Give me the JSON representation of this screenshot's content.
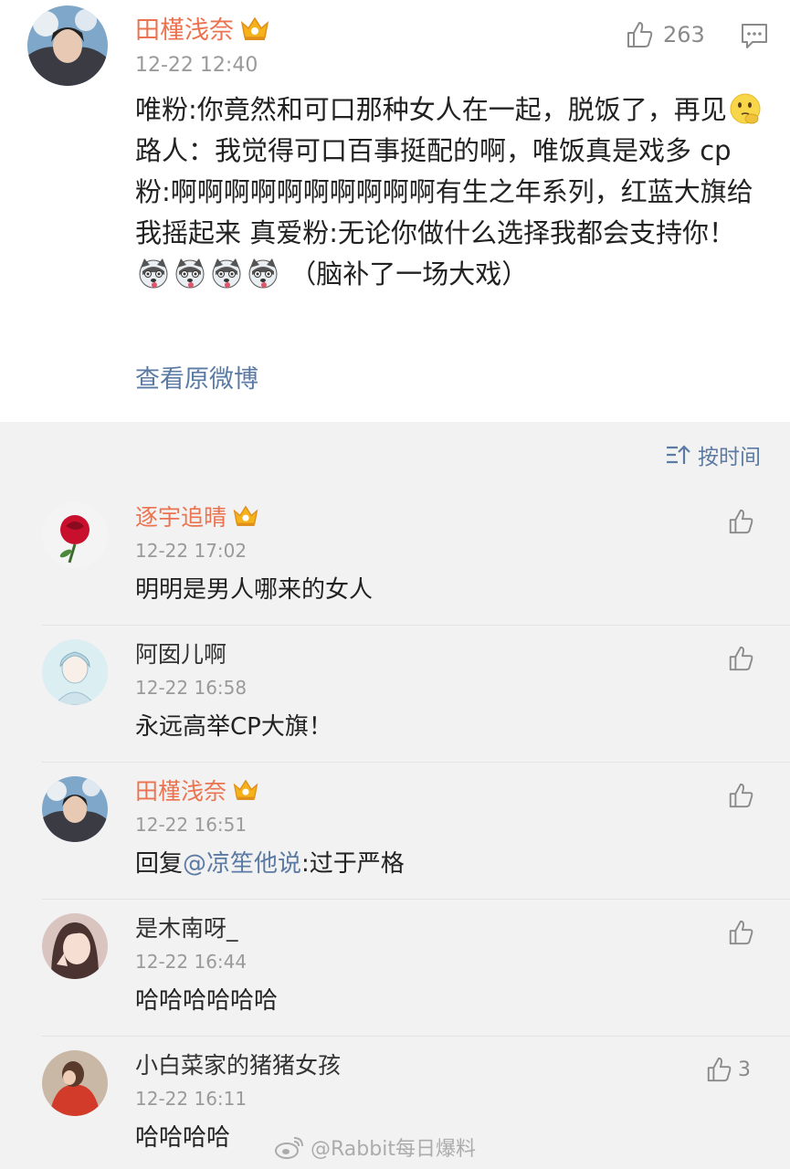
{
  "post": {
    "author": "田槿浅奈",
    "time": "12-22 12:40",
    "like_count": "263",
    "text_part1": "唯粉:你竟然和可口那种女人在一起，脱饭了，再见",
    "text_part2": " 路人：我觉得可口百事挺配的啊，唯饭真是戏多 cp粉:啊啊啊啊啊啊啊啊啊啊有生之年系列，红蓝大旗给我摇起来 真爱粉:无论你做什么选择我都会支持你！",
    "text_part3": "（脑补了一场大戏）",
    "view_original": "查看原微博"
  },
  "sort": {
    "label": "按时间"
  },
  "comments": [
    {
      "name": "逐宇追晴",
      "time": "12-22 17:02",
      "text": "明明是男人哪来的女人",
      "likes": ""
    },
    {
      "name": "阿囡儿啊",
      "time": "12-22 16:58",
      "text": "永远高举CP大旗！",
      "likes": ""
    },
    {
      "name": "田槿浅奈",
      "time": "12-22 16:51",
      "reply_prefix": "回复",
      "mention": "@凉笙他说",
      "reply_text": ":过于严格",
      "likes": ""
    },
    {
      "name": "是木南呀_",
      "time": "12-22 16:44",
      "text": "哈哈哈哈哈哈",
      "likes": ""
    },
    {
      "name": "小白菜家的猪猪女孩",
      "time": "12-22 16:11",
      "text": "哈哈哈哈",
      "likes": "3"
    }
  ],
  "watermark": "@Rabbit每日爆料",
  "colors": {
    "vip_name": "#eb7350",
    "link": "#5b7ba4",
    "meta": "#9a9a9a"
  },
  "icons": [
    "crown-badge-icon",
    "thumbs-up-icon",
    "comment-icon",
    "sort-icon",
    "thinking-emoji-icon",
    "husky-emoji-icon",
    "weibo-logo-icon"
  ]
}
